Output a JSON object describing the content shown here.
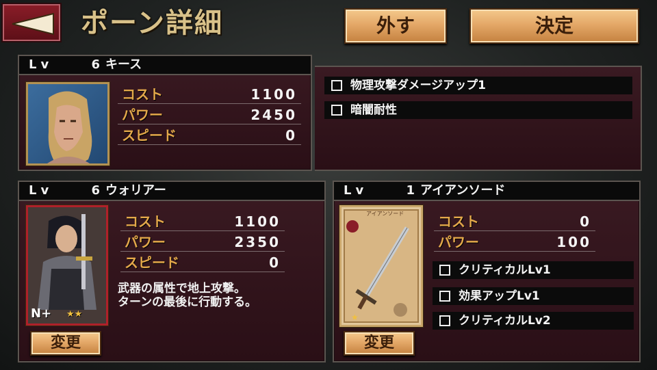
{
  "header": {
    "title": "ポーン詳細",
    "unequip_label": "外す",
    "confirm_label": "決定"
  },
  "pawn": {
    "lv_label": "Lv",
    "level": "6",
    "name": "キース",
    "stats": [
      {
        "label": "コスト",
        "value": "1100"
      },
      {
        "label": "パワー",
        "value": "2450"
      },
      {
        "label": "スピード",
        "value": "0"
      }
    ],
    "abilities": [
      "物理攻撃ダメージアップ1",
      "暗闇耐性"
    ]
  },
  "job": {
    "lv_label": "Lv",
    "level": "6",
    "name": "ウォリアー",
    "stats": [
      {
        "label": "コスト",
        "value": "1100"
      },
      {
        "label": "パワー",
        "value": "2350"
      },
      {
        "label": "スピード",
        "value": "0"
      }
    ],
    "description_line1": "武器の属性で地上攻撃。",
    "description_line2": "ターンの最後に行動する。",
    "card_rank": "N+",
    "card_stars": "★★",
    "change_label": "変更"
  },
  "weapon": {
    "lv_label": "Lv",
    "level": "1",
    "name": "アイアンソード",
    "card_caption": "アイアンソード",
    "card_star": "★",
    "stats": [
      {
        "label": "コスト",
        "value": "0"
      },
      {
        "label": "パワー",
        "value": "100"
      }
    ],
    "abilities": [
      "クリティカルLv1",
      "効果アップLv1",
      "クリティカルLv2"
    ],
    "change_label": "変更"
  },
  "colors": {
    "stat_label": "#e3a84a",
    "panel_bg": "#2a0f16",
    "button_tan": "#e4a868",
    "back_red": "#8a1d28"
  }
}
